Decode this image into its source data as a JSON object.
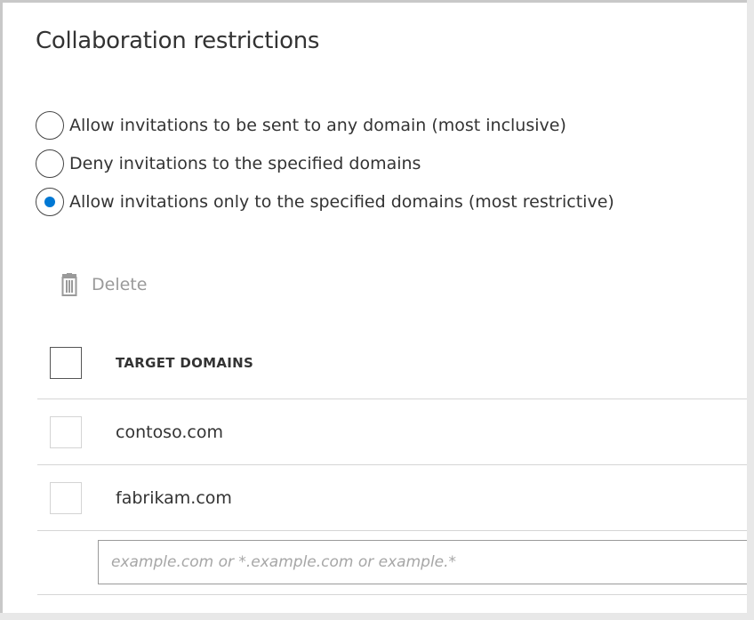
{
  "panel": {
    "title": "Collaboration restrictions"
  },
  "restriction_options": [
    {
      "label": "Allow invitations to be sent to any domain (most inclusive)",
      "selected": false
    },
    {
      "label": "Deny invitations to the specified domains",
      "selected": false
    },
    {
      "label": "Allow invitations only to the specified domains (most restrictive)",
      "selected": true
    }
  ],
  "toolbar": {
    "delete_label": "Delete",
    "delete_icon": "trash-icon"
  },
  "table": {
    "column_header": "TARGET DOMAINS",
    "rows": [
      {
        "domain": "contoso.com"
      },
      {
        "domain": "fabrikam.com"
      }
    ],
    "new_domain_input": {
      "value": "",
      "placeholder": "example.com or *.example.com or example.*"
    }
  },
  "colors": {
    "accent": "#0078d4",
    "disabled_text": "#9a9a9a",
    "divider": "#d6d6d6"
  }
}
